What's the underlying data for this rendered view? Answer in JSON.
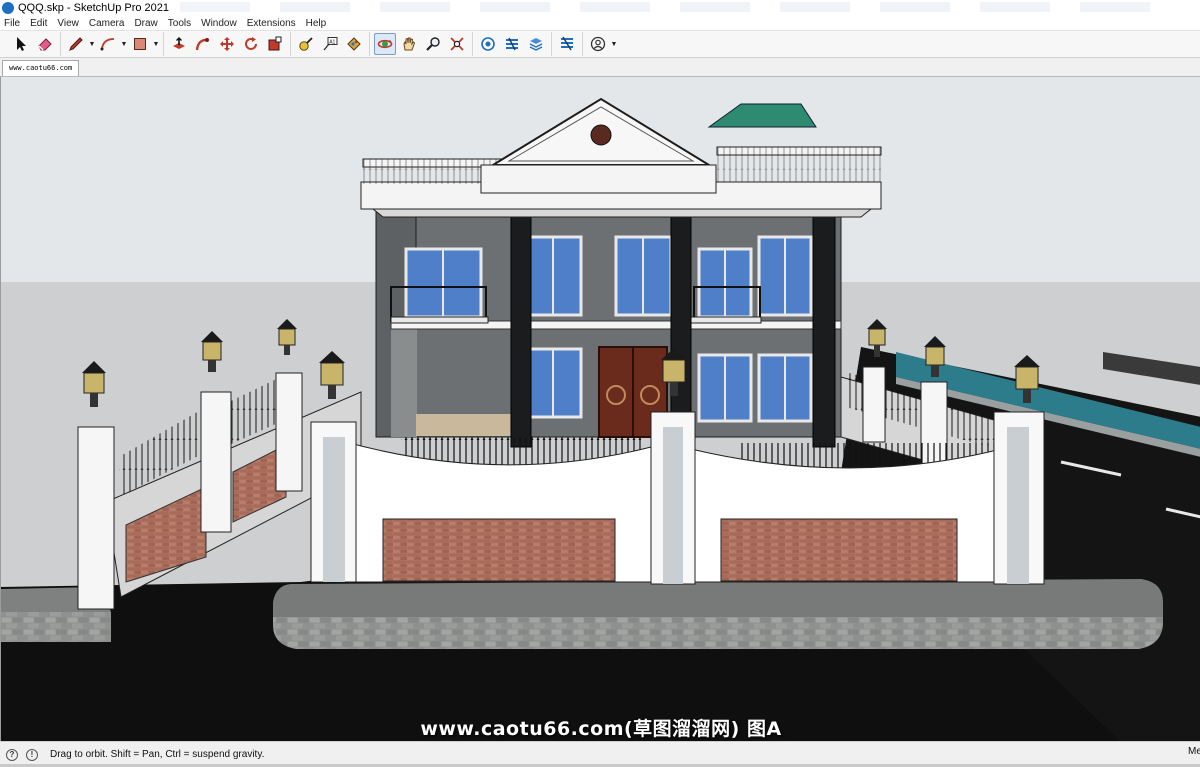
{
  "window": {
    "title": "QQQ.skp - SketchUp Pro 2021"
  },
  "menubar": {
    "items": [
      "File",
      "Edit",
      "View",
      "Camera",
      "Draw",
      "Tools",
      "Window",
      "Extensions",
      "Help"
    ]
  },
  "toolbar": {
    "tools": [
      {
        "name": "select-icon",
        "active": false
      },
      {
        "name": "eraser-icon",
        "active": false
      },
      {
        "name": "pencil-line-icon",
        "active": false,
        "dropdown": true
      },
      {
        "name": "arc-icon",
        "active": false,
        "dropdown": true
      },
      {
        "name": "rectangle-icon",
        "active": false,
        "dropdown": true
      },
      {
        "name": "push-pull-icon",
        "active": false
      },
      {
        "name": "follow-me-icon",
        "active": false
      },
      {
        "name": "move-icon",
        "active": false
      },
      {
        "name": "rotate-icon",
        "active": false
      },
      {
        "name": "scale-icon",
        "active": false
      },
      {
        "name": "tape-measure-icon",
        "active": false
      },
      {
        "name": "text-icon",
        "active": false
      },
      {
        "name": "paint-bucket-icon",
        "active": false
      },
      {
        "name": "orbit-icon",
        "active": true
      },
      {
        "name": "pan-icon",
        "active": false
      },
      {
        "name": "zoom-icon",
        "active": false
      },
      {
        "name": "zoom-extents-icon",
        "active": false
      },
      {
        "name": "warehouse-icon",
        "active": false
      },
      {
        "name": "extension-warehouse-icon",
        "active": false
      },
      {
        "name": "layout-icon",
        "active": false
      },
      {
        "name": "extension-manager-icon",
        "active": false
      },
      {
        "name": "account-icon",
        "active": false,
        "dropdown": true
      }
    ]
  },
  "scene": {
    "tab_label": "www.caotu66.com"
  },
  "viewport": {
    "watermark": "www.caotu66.com(草图溜溜网) 图A",
    "colors": {
      "sky": "#e6e9ec",
      "ground": "#c9cbcc",
      "road": "#111111",
      "facade": "#6f7274",
      "window_glass": "#4f7fc9",
      "roof": "#2e8a70",
      "brick": "#a96b58",
      "wall_white": "#ffffff",
      "water": "#2e7e8e"
    }
  },
  "statusbar": {
    "hint": "Drag to orbit. Shift = Pan, Ctrl = suspend gravity.",
    "measurement_label": "Me"
  }
}
